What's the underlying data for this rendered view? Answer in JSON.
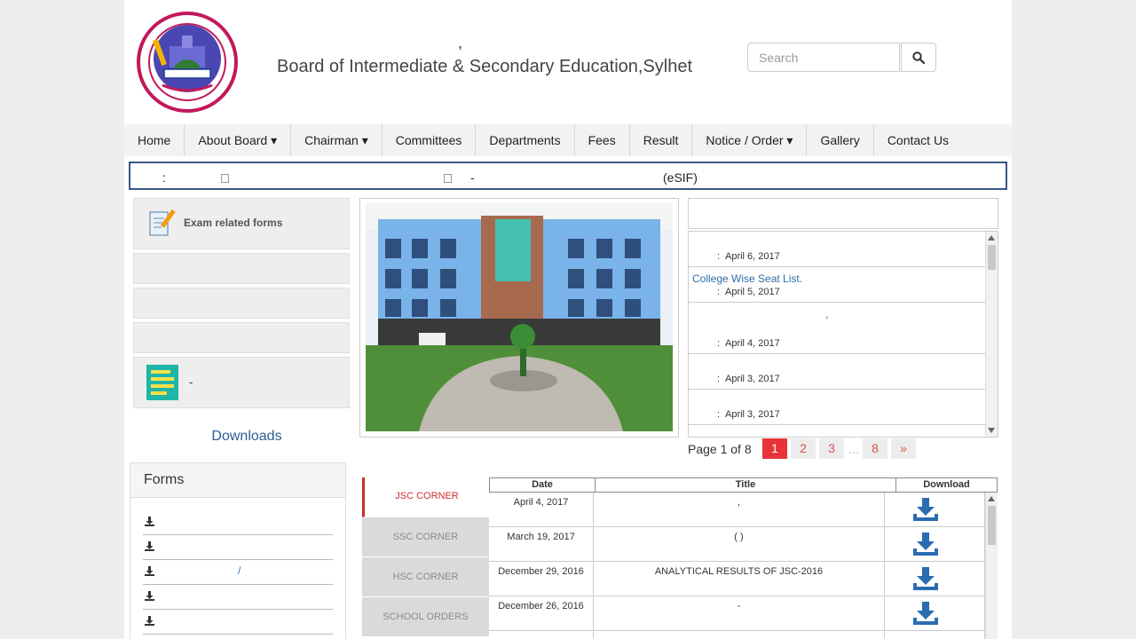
{
  "header": {
    "title_comma": ",",
    "title": "Board of Intermediate & Secondary Education,Sylhet",
    "search_placeholder": "Search"
  },
  "nav": {
    "items": [
      {
        "label": "Home"
      },
      {
        "label": "About Board ▾"
      },
      {
        "label": "Chairman ▾"
      },
      {
        "label": "Committees"
      },
      {
        "label": "Departments"
      },
      {
        "label": "Fees"
      },
      {
        "label": "Result"
      },
      {
        "label": "Notice / Order ▾"
      },
      {
        "label": "Gallery"
      },
      {
        "label": "Contact Us"
      }
    ]
  },
  "marquee": {
    "colon": ":",
    "dash": "-",
    "esif": "(eSIF)"
  },
  "sidebar": {
    "exam_forms": "Exam related forms",
    "fifth_panel_text": "-",
    "downloads_heading": "Downloads",
    "forms_heading": "Forms",
    "form_links": [
      "",
      "",
      "/",
      "",
      ""
    ]
  },
  "notices": {
    "items": [
      {
        "title": "",
        "colon": ":",
        "date": "April 6, 2017"
      },
      {
        "title": "College Wise Seat List.",
        "colon": ":",
        "date": "April 5, 2017"
      },
      {
        "title": ",",
        "colon": ":",
        "date": "April 4, 2017"
      },
      {
        "title": "",
        "colon": ":",
        "date": "April 3, 2017"
      },
      {
        "title": "",
        "colon": ":",
        "date": "April 3, 2017"
      }
    ]
  },
  "pagination": {
    "info": "Page 1 of 8",
    "pages": [
      "1",
      "2",
      "3",
      "8"
    ],
    "ellipsis": "…",
    "next": "»",
    "current": 1
  },
  "corner": {
    "tabs": [
      "JSC CORNER",
      "SSC CORNER",
      "HSC CORNER",
      "SCHOOL ORDERS"
    ],
    "active_tab": "JSC CORNER",
    "columns": [
      "Date",
      "Title",
      "Download"
    ],
    "rows": [
      {
        "date": "April 4, 2017",
        "title": ","
      },
      {
        "date": "March 19, 2017",
        "title": "(                  )"
      },
      {
        "date": "December 29, 2016",
        "title": "ANALYTICAL RESULTS OF JSC-2016"
      },
      {
        "date": "December 26, 2016",
        "title": "-"
      }
    ]
  },
  "colors": {
    "accent_red": "#e8333b",
    "link_blue": "#2e6ea6",
    "download_blue": "#2a6cb0",
    "marquee_border": "#3a5583"
  }
}
